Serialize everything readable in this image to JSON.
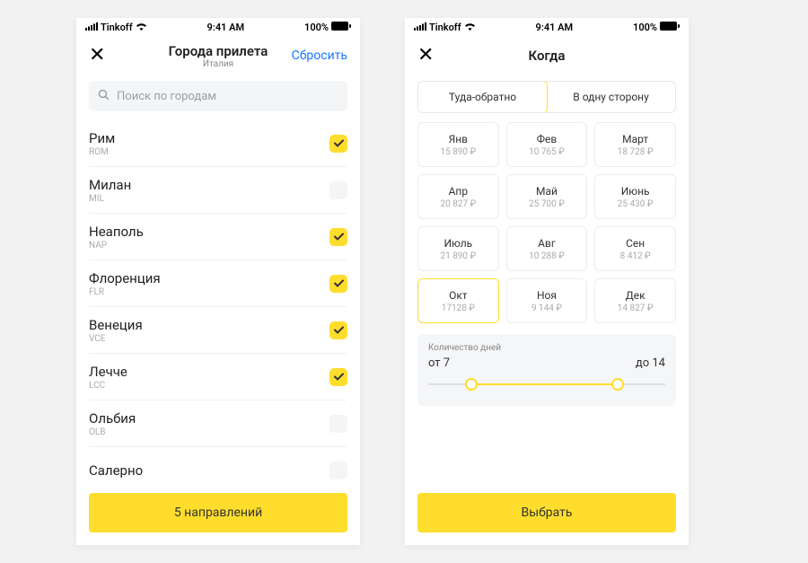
{
  "status": {
    "carrier": "Tinkoff",
    "time": "9:41 AM",
    "battery": "100%"
  },
  "left": {
    "title": "Города прилета",
    "subtitle": "Италия",
    "reset": "Сбросить",
    "search_placeholder": "Поиск по городам",
    "cities": [
      {
        "name": "Рим",
        "code": "ROM",
        "checked": true
      },
      {
        "name": "Милан",
        "code": "MIL",
        "checked": false
      },
      {
        "name": "Неаполь",
        "code": "NAP",
        "checked": true
      },
      {
        "name": "Флоренция",
        "code": "FLR",
        "checked": true
      },
      {
        "name": "Венеция",
        "code": "VCE",
        "checked": true
      },
      {
        "name": "Лечче",
        "code": "LCC",
        "checked": true
      },
      {
        "name": "Ольбия",
        "code": "OLB",
        "checked": false
      },
      {
        "name": "Салерно",
        "code": "",
        "checked": false
      }
    ],
    "button": "5 направлений"
  },
  "right": {
    "title": "Когда",
    "tabs": [
      "Туда-обратно",
      "В одну сторону"
    ],
    "active_tab": 0,
    "months": [
      {
        "name": "Янв",
        "price": "15 890 ₽"
      },
      {
        "name": "Фев",
        "price": "10 765 ₽"
      },
      {
        "name": "Март",
        "price": "18 728 ₽"
      },
      {
        "name": "Апр",
        "price": "20 827 ₽"
      },
      {
        "name": "Май",
        "price": "25 700 ₽"
      },
      {
        "name": "Июнь",
        "price": "25 430 ₽"
      },
      {
        "name": "Июль",
        "price": "21 890 ₽"
      },
      {
        "name": "Авг",
        "price": "10 288 ₽"
      },
      {
        "name": "Сен",
        "price": "8 412 ₽"
      },
      {
        "name": "Окт",
        "price": "17128 ₽"
      },
      {
        "name": "Ноя",
        "price": "9 144 ₽"
      },
      {
        "name": "Дек",
        "price": "14 827 ₽"
      }
    ],
    "selected_month": 9,
    "days_label": "Количество дней",
    "days_from": "от 7",
    "days_to": "до 14",
    "button": "Выбрать"
  }
}
